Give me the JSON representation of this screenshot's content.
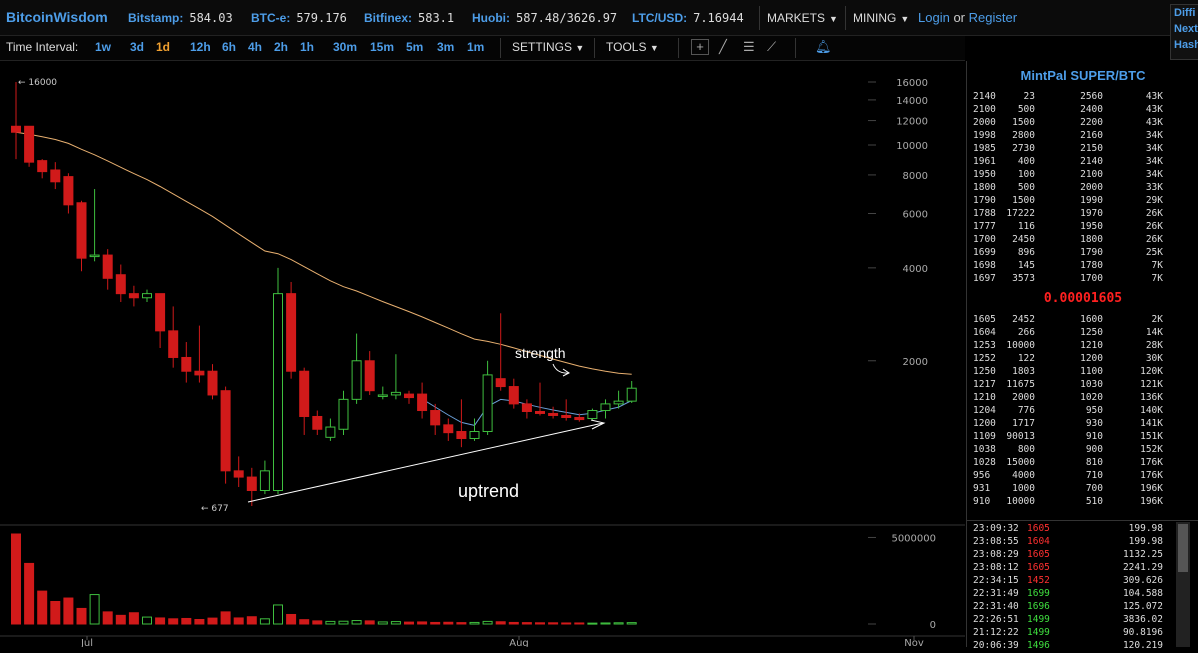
{
  "header": {
    "brand": "BitcoinWisdom",
    "tickers": [
      {
        "label": "Bitstamp:",
        "value": "584.03"
      },
      {
        "label": "BTC-e:",
        "value": "579.176"
      },
      {
        "label": "Bitfinex:",
        "value": "583.1"
      },
      {
        "label": "Huobi:",
        "value": "587.48/3626.97"
      },
      {
        "label": "LTC/USD:",
        "value": "7.16944"
      }
    ],
    "markets_label": "MARKETS",
    "mining_label": "MINING",
    "login_label": "Login",
    "or_label": "or",
    "register_label": "Register",
    "side_labels": [
      "Diffi",
      "Next",
      "Hash"
    ]
  },
  "toolbar": {
    "time_interval_label": "Time Interval:",
    "intervals": [
      "1w",
      "3d",
      "1d",
      "12h",
      "6h",
      "4h",
      "2h",
      "1h",
      "30m",
      "15m",
      "5m",
      "3m",
      "1m"
    ],
    "active_interval": "1d",
    "settings_label": "SETTINGS",
    "tools_label": "TOOLS"
  },
  "chart_data": {
    "type": "candlestick",
    "price_axis_ticks": [
      "16000",
      "14000",
      "12000",
      "10000",
      "8000",
      "6000",
      "4000",
      "2000"
    ],
    "volume_axis_ticks": [
      "5000000",
      "0"
    ],
    "x_labels": [
      "Jul",
      "Aug",
      "Nov"
    ],
    "high_marker": "← 16000",
    "low_marker": "← 677",
    "annotations": [
      "strength",
      "uptrend"
    ],
    "colors": {
      "up": "#3fbf3f",
      "down": "#d11a1a",
      "ma_long": "#e8b070",
      "ma_short": "#6a9fd8"
    },
    "candles": [
      {
        "o": 11500,
        "c": 11000,
        "h": 16000,
        "l": 9000
      },
      {
        "o": 11500,
        "c": 8800,
        "h": 11500,
        "l": 8500
      },
      {
        "o": 8900,
        "c": 8200,
        "h": 9000,
        "l": 7800
      },
      {
        "o": 8300,
        "c": 7600,
        "h": 8800,
        "l": 7200
      },
      {
        "o": 7900,
        "c": 6400,
        "h": 8100,
        "l": 6000
      },
      {
        "o": 6500,
        "c": 4300,
        "h": 6600,
        "l": 3900
      },
      {
        "o": 4400,
        "c": 4400,
        "h": 7200,
        "l": 4200
      },
      {
        "o": 4400,
        "c": 3700,
        "h": 4600,
        "l": 3400
      },
      {
        "o": 3800,
        "c": 3300,
        "h": 4100,
        "l": 3100
      },
      {
        "o": 3300,
        "c": 3200,
        "h": 3500,
        "l": 3000
      },
      {
        "o": 3200,
        "c": 3300,
        "h": 3400,
        "l": 3100
      },
      {
        "o": 3300,
        "c": 2500,
        "h": 3300,
        "l": 2200
      },
      {
        "o": 2500,
        "c": 2050,
        "h": 3000,
        "l": 1900
      },
      {
        "o": 2050,
        "c": 1850,
        "h": 2300,
        "l": 1700
      },
      {
        "o": 1850,
        "c": 1800,
        "h": 2600,
        "l": 1700
      },
      {
        "o": 1850,
        "c": 1550,
        "h": 1950,
        "l": 1500
      },
      {
        "o": 1600,
        "c": 880,
        "h": 1650,
        "l": 800
      },
      {
        "o": 880,
        "c": 840,
        "h": 980,
        "l": 780
      },
      {
        "o": 840,
        "c": 760,
        "h": 900,
        "l": 677
      },
      {
        "o": 760,
        "c": 880,
        "h": 950,
        "l": 740
      },
      {
        "o": 760,
        "c": 3300,
        "h": 4000,
        "l": 740
      },
      {
        "o": 3300,
        "c": 1850,
        "h": 3600,
        "l": 1750
      },
      {
        "o": 1850,
        "c": 1320,
        "h": 1900,
        "l": 1150
      },
      {
        "o": 1320,
        "c": 1200,
        "h": 1380,
        "l": 1150
      },
      {
        "o": 1130,
        "c": 1220,
        "h": 1300,
        "l": 1100
      },
      {
        "o": 1200,
        "c": 1500,
        "h": 1600,
        "l": 1150
      },
      {
        "o": 1500,
        "c": 2000,
        "h": 2450,
        "l": 1450
      },
      {
        "o": 2000,
        "c": 1600,
        "h": 2150,
        "l": 1550
      },
      {
        "o": 1550,
        "c": 1550,
        "h": 1650,
        "l": 1500
      },
      {
        "o": 1550,
        "c": 1580,
        "h": 2100,
        "l": 1500
      },
      {
        "o": 1560,
        "c": 1520,
        "h": 1600,
        "l": 1450
      },
      {
        "o": 1560,
        "c": 1380,
        "h": 1700,
        "l": 1300
      },
      {
        "o": 1380,
        "c": 1240,
        "h": 1450,
        "l": 1150
      },
      {
        "o": 1240,
        "c": 1170,
        "h": 1300,
        "l": 1100
      },
      {
        "o": 1180,
        "c": 1120,
        "h": 1500,
        "l": 1050
      },
      {
        "o": 1120,
        "c": 1180,
        "h": 1300,
        "l": 1100
      },
      {
        "o": 1180,
        "c": 1800,
        "h": 2000,
        "l": 1150
      },
      {
        "o": 1750,
        "c": 1650,
        "h": 2850,
        "l": 1600
      },
      {
        "o": 1650,
        "c": 1450,
        "h": 1750,
        "l": 1400
      },
      {
        "o": 1450,
        "c": 1370,
        "h": 1500,
        "l": 1300
      },
      {
        "o": 1370,
        "c": 1350,
        "h": 1700,
        "l": 1330
      },
      {
        "o": 1350,
        "c": 1330,
        "h": 1420,
        "l": 1300
      },
      {
        "o": 1330,
        "c": 1310,
        "h": 1500,
        "l": 1280
      },
      {
        "o": 1310,
        "c": 1290,
        "h": 1350,
        "l": 1270
      },
      {
        "o": 1300,
        "c": 1380,
        "h": 1400,
        "l": 1280
      },
      {
        "o": 1380,
        "c": 1450,
        "h": 1500,
        "l": 1300
      },
      {
        "o": 1450,
        "c": 1480,
        "h": 1600,
        "l": 1400
      },
      {
        "o": 1480,
        "c": 1630,
        "h": 1720,
        "l": 1460
      }
    ],
    "volumes": [
      5200000,
      3500000,
      1900000,
      1300000,
      1500000,
      900000,
      1700000,
      700000,
      500000,
      650000,
      400000,
      350000,
      300000,
      320000,
      260000,
      340000,
      700000,
      350000,
      420000,
      300000,
      1100000,
      550000,
      250000,
      180000,
      150000,
      160000,
      200000,
      180000,
      120000,
      140000,
      110000,
      120000,
      90000,
      100000,
      80000,
      90000,
      150000,
      130000,
      90000,
      80000,
      70000,
      70000,
      60000,
      60000,
      50000,
      60000,
      70000,
      80000
    ]
  },
  "orderbook": {
    "title": "MintPal SUPER/BTC",
    "asks": [
      [
        "2140",
        "23",
        "2560",
        "43K"
      ],
      [
        "2100",
        "500",
        "2400",
        "43K"
      ],
      [
        "2000",
        "1500",
        "2200",
        "43K"
      ],
      [
        "1998",
        "2800",
        "2160",
        "34K"
      ],
      [
        "1985",
        "2730",
        "2150",
        "34K"
      ],
      [
        "1961",
        "400",
        "2140",
        "34K"
      ],
      [
        "1950",
        "100",
        "2100",
        "34K"
      ],
      [
        "1800",
        "500",
        "2000",
        "33K"
      ],
      [
        "1790",
        "1500",
        "1990",
        "29K"
      ],
      [
        "1788",
        "17222",
        "1970",
        "26K"
      ],
      [
        "1777",
        "116",
        "1950",
        "26K"
      ],
      [
        "1700",
        "2450",
        "1800",
        "26K"
      ],
      [
        "1699",
        "896",
        "1790",
        "25K"
      ],
      [
        "1698",
        "145",
        "1780",
        "7K"
      ],
      [
        "1697",
        "3573",
        "1700",
        "7K"
      ]
    ],
    "last_price": "0.00001605",
    "bids": [
      [
        "1605",
        "2452",
        "1600",
        "2K"
      ],
      [
        "1604",
        "266",
        "1250",
        "14K"
      ],
      [
        "1253",
        "10000",
        "1210",
        "28K"
      ],
      [
        "1252",
        "122",
        "1200",
        "30K"
      ],
      [
        "1250",
        "1803",
        "1100",
        "120K"
      ],
      [
        "1217",
        "11675",
        "1030",
        "121K"
      ],
      [
        "1210",
        "2000",
        "1020",
        "136K"
      ],
      [
        "1204",
        "776",
        "950",
        "140K"
      ],
      [
        "1200",
        "1717",
        "930",
        "141K"
      ],
      [
        "1109",
        "90013",
        "910",
        "151K"
      ],
      [
        "1038",
        "800",
        "900",
        "152K"
      ],
      [
        "1028",
        "15000",
        "810",
        "176K"
      ],
      [
        "956",
        "4000",
        "710",
        "176K"
      ],
      [
        "931",
        "1000",
        "700",
        "196K"
      ],
      [
        "910",
        "10000",
        "510",
        "196K"
      ]
    ],
    "trades": [
      {
        "time": "23:09:32",
        "price": "1605",
        "dir": "sell",
        "amount": "199.98"
      },
      {
        "time": "23:08:55",
        "price": "1604",
        "dir": "sell",
        "amount": "199.98"
      },
      {
        "time": "23:08:29",
        "price": "1605",
        "dir": "sell",
        "amount": "1132.25"
      },
      {
        "time": "23:08:12",
        "price": "1605",
        "dir": "sell",
        "amount": "2241.29"
      },
      {
        "time": "22:34:15",
        "price": "1452",
        "dir": "sell",
        "amount": "309.626"
      },
      {
        "time": "22:31:49",
        "price": "1699",
        "dir": "buy",
        "amount": "104.588"
      },
      {
        "time": "22:31:40",
        "price": "1696",
        "dir": "buy",
        "amount": "125.072"
      },
      {
        "time": "22:26:51",
        "price": "1499",
        "dir": "buy",
        "amount": "3836.02"
      },
      {
        "time": "21:12:22",
        "price": "1499",
        "dir": "buy",
        "amount": "90.8196"
      },
      {
        "time": "20:06:39",
        "price": "1496",
        "dir": "buy",
        "amount": "120.219"
      }
    ]
  }
}
